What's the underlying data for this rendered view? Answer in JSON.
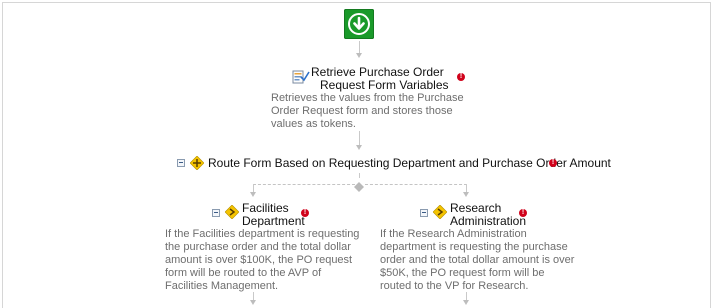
{
  "workflow": {
    "start": {
      "icon": "download-arrow-icon"
    },
    "retrieve_step": {
      "title_line1": "Retrieve Purchase Order",
      "title_line2": "Request Form Variables",
      "desc_line1": "Retrieves the values from the Purchase",
      "desc_line2": "Order Request form and stores those",
      "desc_line3": "values as tokens.",
      "error_icon": "error-icon",
      "step_icon": "form-variables-icon"
    },
    "route_step": {
      "title": "Route Form Based on Requesting Department and Purchase Order Amount",
      "error_icon": "error-icon",
      "step_icon": "route-icon"
    },
    "branches": [
      {
        "title_line1": "Facilities",
        "title_line2": "Department",
        "desc_line1": "If the Facilities department is requesting",
        "desc_line2": "the purchase order and the total dollar",
        "desc_line3": "amount is over $100K, the PO request",
        "desc_line4": "form will be routed to the AVP of",
        "desc_line5": "Facilities Management."
      },
      {
        "title_line1": "Research",
        "title_line2": "Administration",
        "desc_line1": "If the Research Administration",
        "desc_line2": "department is requesting the purchase",
        "desc_line3": "order and the total dollar amount is over",
        "desc_line4": "$50K, the PO request form will be",
        "desc_line5": "routed to the VP for Research."
      }
    ],
    "colors": {
      "start": "#1a9a2a",
      "error": "#d0021b",
      "route_icon": "#f5c400",
      "connector": "#c9c9c9"
    }
  }
}
